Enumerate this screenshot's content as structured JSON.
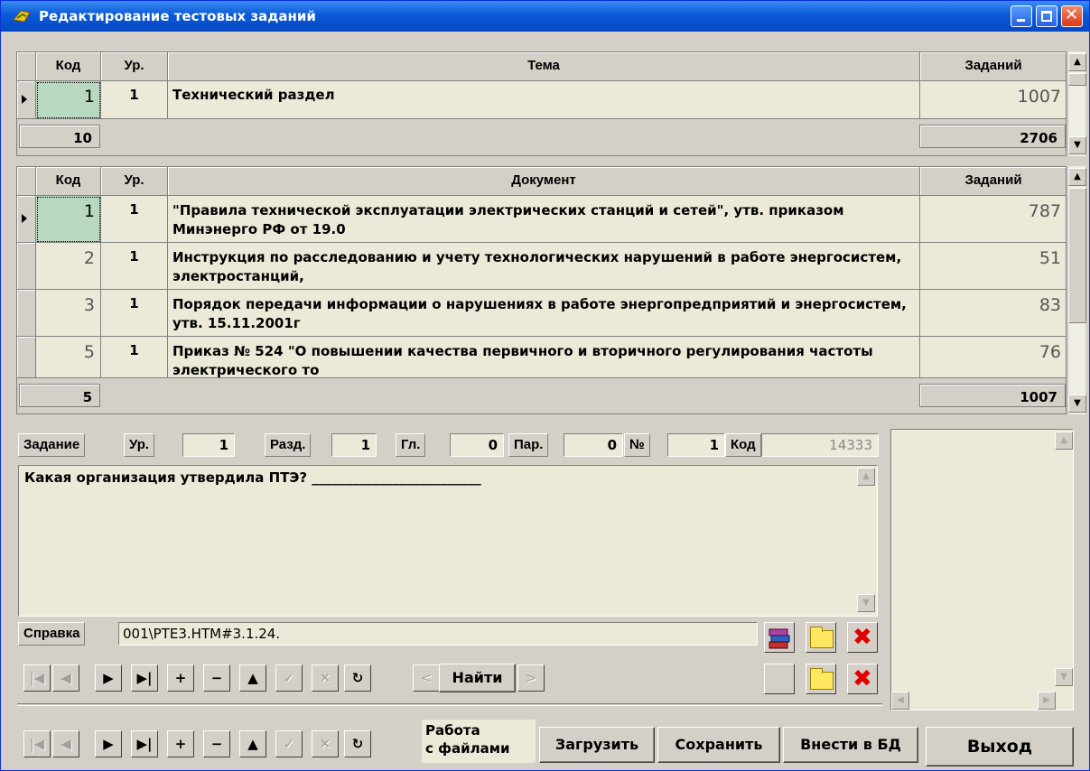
{
  "window": {
    "title": "Редактирование тестовых заданий"
  },
  "topics_grid": {
    "headers": {
      "code": "Код",
      "level": "Ур.",
      "topic": "Тема",
      "tasks": "Заданий"
    },
    "rows": [
      {
        "code": "1",
        "level": "1",
        "topic": "Технический раздел",
        "tasks": "1007"
      }
    ],
    "footer": {
      "count": "10",
      "total": "2706"
    }
  },
  "documents_grid": {
    "headers": {
      "code": "Код",
      "level": "Ур.",
      "document": "Документ",
      "tasks": "Заданий"
    },
    "rows": [
      {
        "code": "1",
        "level": "1",
        "document": "\"Правила технической эксплуатации электрических станций и сетей\", утв. приказом Минэнерго РФ от 19.0",
        "tasks": "787"
      },
      {
        "code": "2",
        "level": "1",
        "document": "Инструкция по расследованию и учету технологических нарушений в работе энергосистем, электростанций,",
        "tasks": "51"
      },
      {
        "code": "3",
        "level": "1",
        "document": "Порядок передачи информации о нарушениях в работе энергопредприятий и энергосистем, утв. 15.11.2001г",
        "tasks": "83"
      },
      {
        "code": "5",
        "level": "1",
        "document": "Приказ  № 524  \"О повышении качества первичного и вторичного регулирования частоты электрического то",
        "tasks": "76"
      }
    ],
    "footer": {
      "count": "5",
      "total": "1007"
    }
  },
  "task": {
    "labels": {
      "task": "Задание",
      "level": "Ур.",
      "section": "Разд.",
      "chapter": "Гл.",
      "paragraph": "Пар.",
      "number": "№",
      "code": "Код"
    },
    "values": {
      "level": "1",
      "section": "1",
      "chapter": "0",
      "paragraph": "0",
      "number": "1",
      "code": "14333"
    },
    "question": "Какая организация утвердила ПТЭ? _________________________",
    "reference_label": "Справка",
    "reference_value": "001\\PTE3.HTM#3.1.24."
  },
  "nav": {
    "first": "|◀",
    "prev": "◀",
    "next": "▶",
    "last": "▶|",
    "add": "+",
    "delete": "−",
    "up": "▲",
    "post": "✓",
    "cancel": "✕",
    "refresh": "↻"
  },
  "search": {
    "prev": "<",
    "label": "Найти",
    "next": ">"
  },
  "bottom": {
    "files_label": "Работа\nс файлами",
    "load": "Загрузить",
    "save": "Сохранить",
    "import": "Внести в БД",
    "exit": "Выход"
  },
  "icons": {
    "title": "app-icon",
    "books": "books-icon",
    "folder": "folder-icon",
    "delete": "red-x-icon"
  }
}
